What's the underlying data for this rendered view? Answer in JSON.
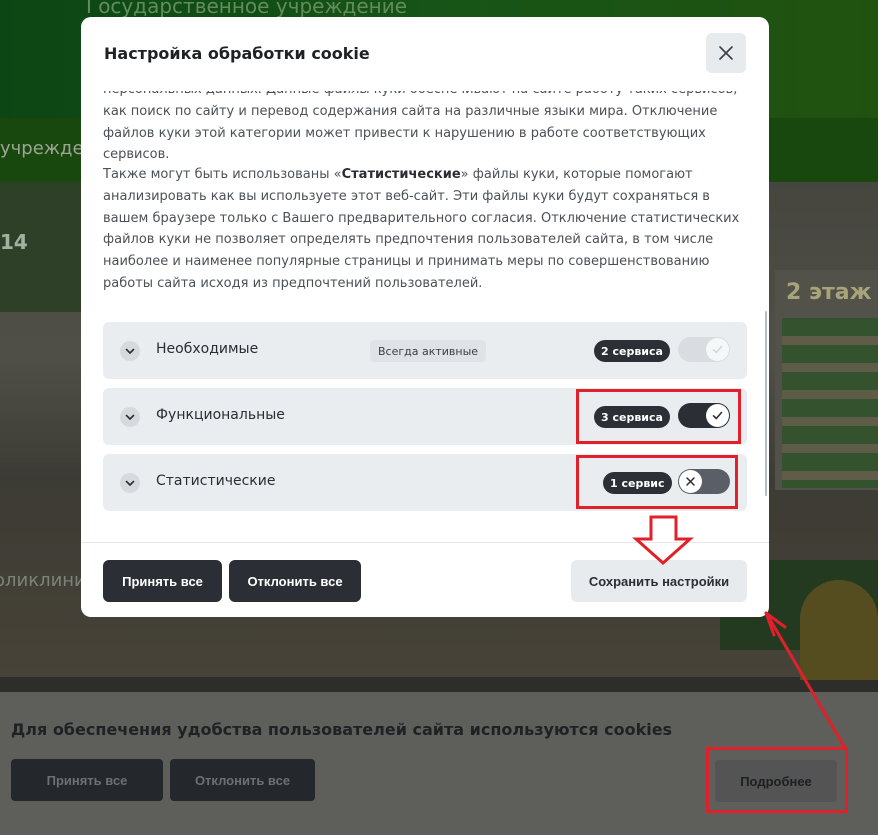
{
  "background": {
    "org_title": "Государственное учреждение",
    "nav_fragment": "учреждении",
    "sign_number": "14",
    "floor_sign": "2 этаж",
    "left_fragment": "оликлини"
  },
  "cookie_bar": {
    "text": "Для обеспечения удобства пользователей сайта используются cookies",
    "accept_label": "Принять все",
    "reject_label": "Отклонить все",
    "more_label": "Подробнее"
  },
  "modal": {
    "title": "Настройка обработки cookie",
    "paragraph1": "персональных данных. Данные файлы куки обеспечивают на сайте работу таких сервисов, как поиск по сайту и перевод содержания сайта на различные языки мира. Отключение файлов куки этой категории может привести к нарушению в работе соответствующих сервисов.",
    "paragraph2_before": "Также могут быть использованы «",
    "paragraph2_bold": "Статистические",
    "paragraph2_after": "» файлы куки, которые помогают анализировать как вы используете этот веб-сайт. Эти файлы куки будут сохраняться в вашем браузере только с Вашего предварительного согласия. Отключение статистических файлов куки не позволяет определять предпочтения пользователей сайта, в том числе наиболее и наименее популярные страницы и принимать меры по совершенствованию работы сайта исходя из предпочтений пользователей.",
    "categories": [
      {
        "name": "Необходимые",
        "always_active": "Всегда активные",
        "services": "2 сервиса",
        "state": "on-disabled"
      },
      {
        "name": "Функциональные",
        "services": "3 сервиса",
        "state": "on"
      },
      {
        "name": "Статистические",
        "services": "1 сервис",
        "state": "off"
      }
    ],
    "footer": {
      "accept_label": "Принять все",
      "reject_label": "Отклонить все",
      "save_label": "Сохранить настройки"
    }
  },
  "colors": {
    "annotation_red": "#e0202a",
    "dark_button": "#2b2f35",
    "light_button": "#e7ebee"
  },
  "icons": [
    "close-icon",
    "chevron-down-icon",
    "check-icon",
    "cross-icon"
  ]
}
